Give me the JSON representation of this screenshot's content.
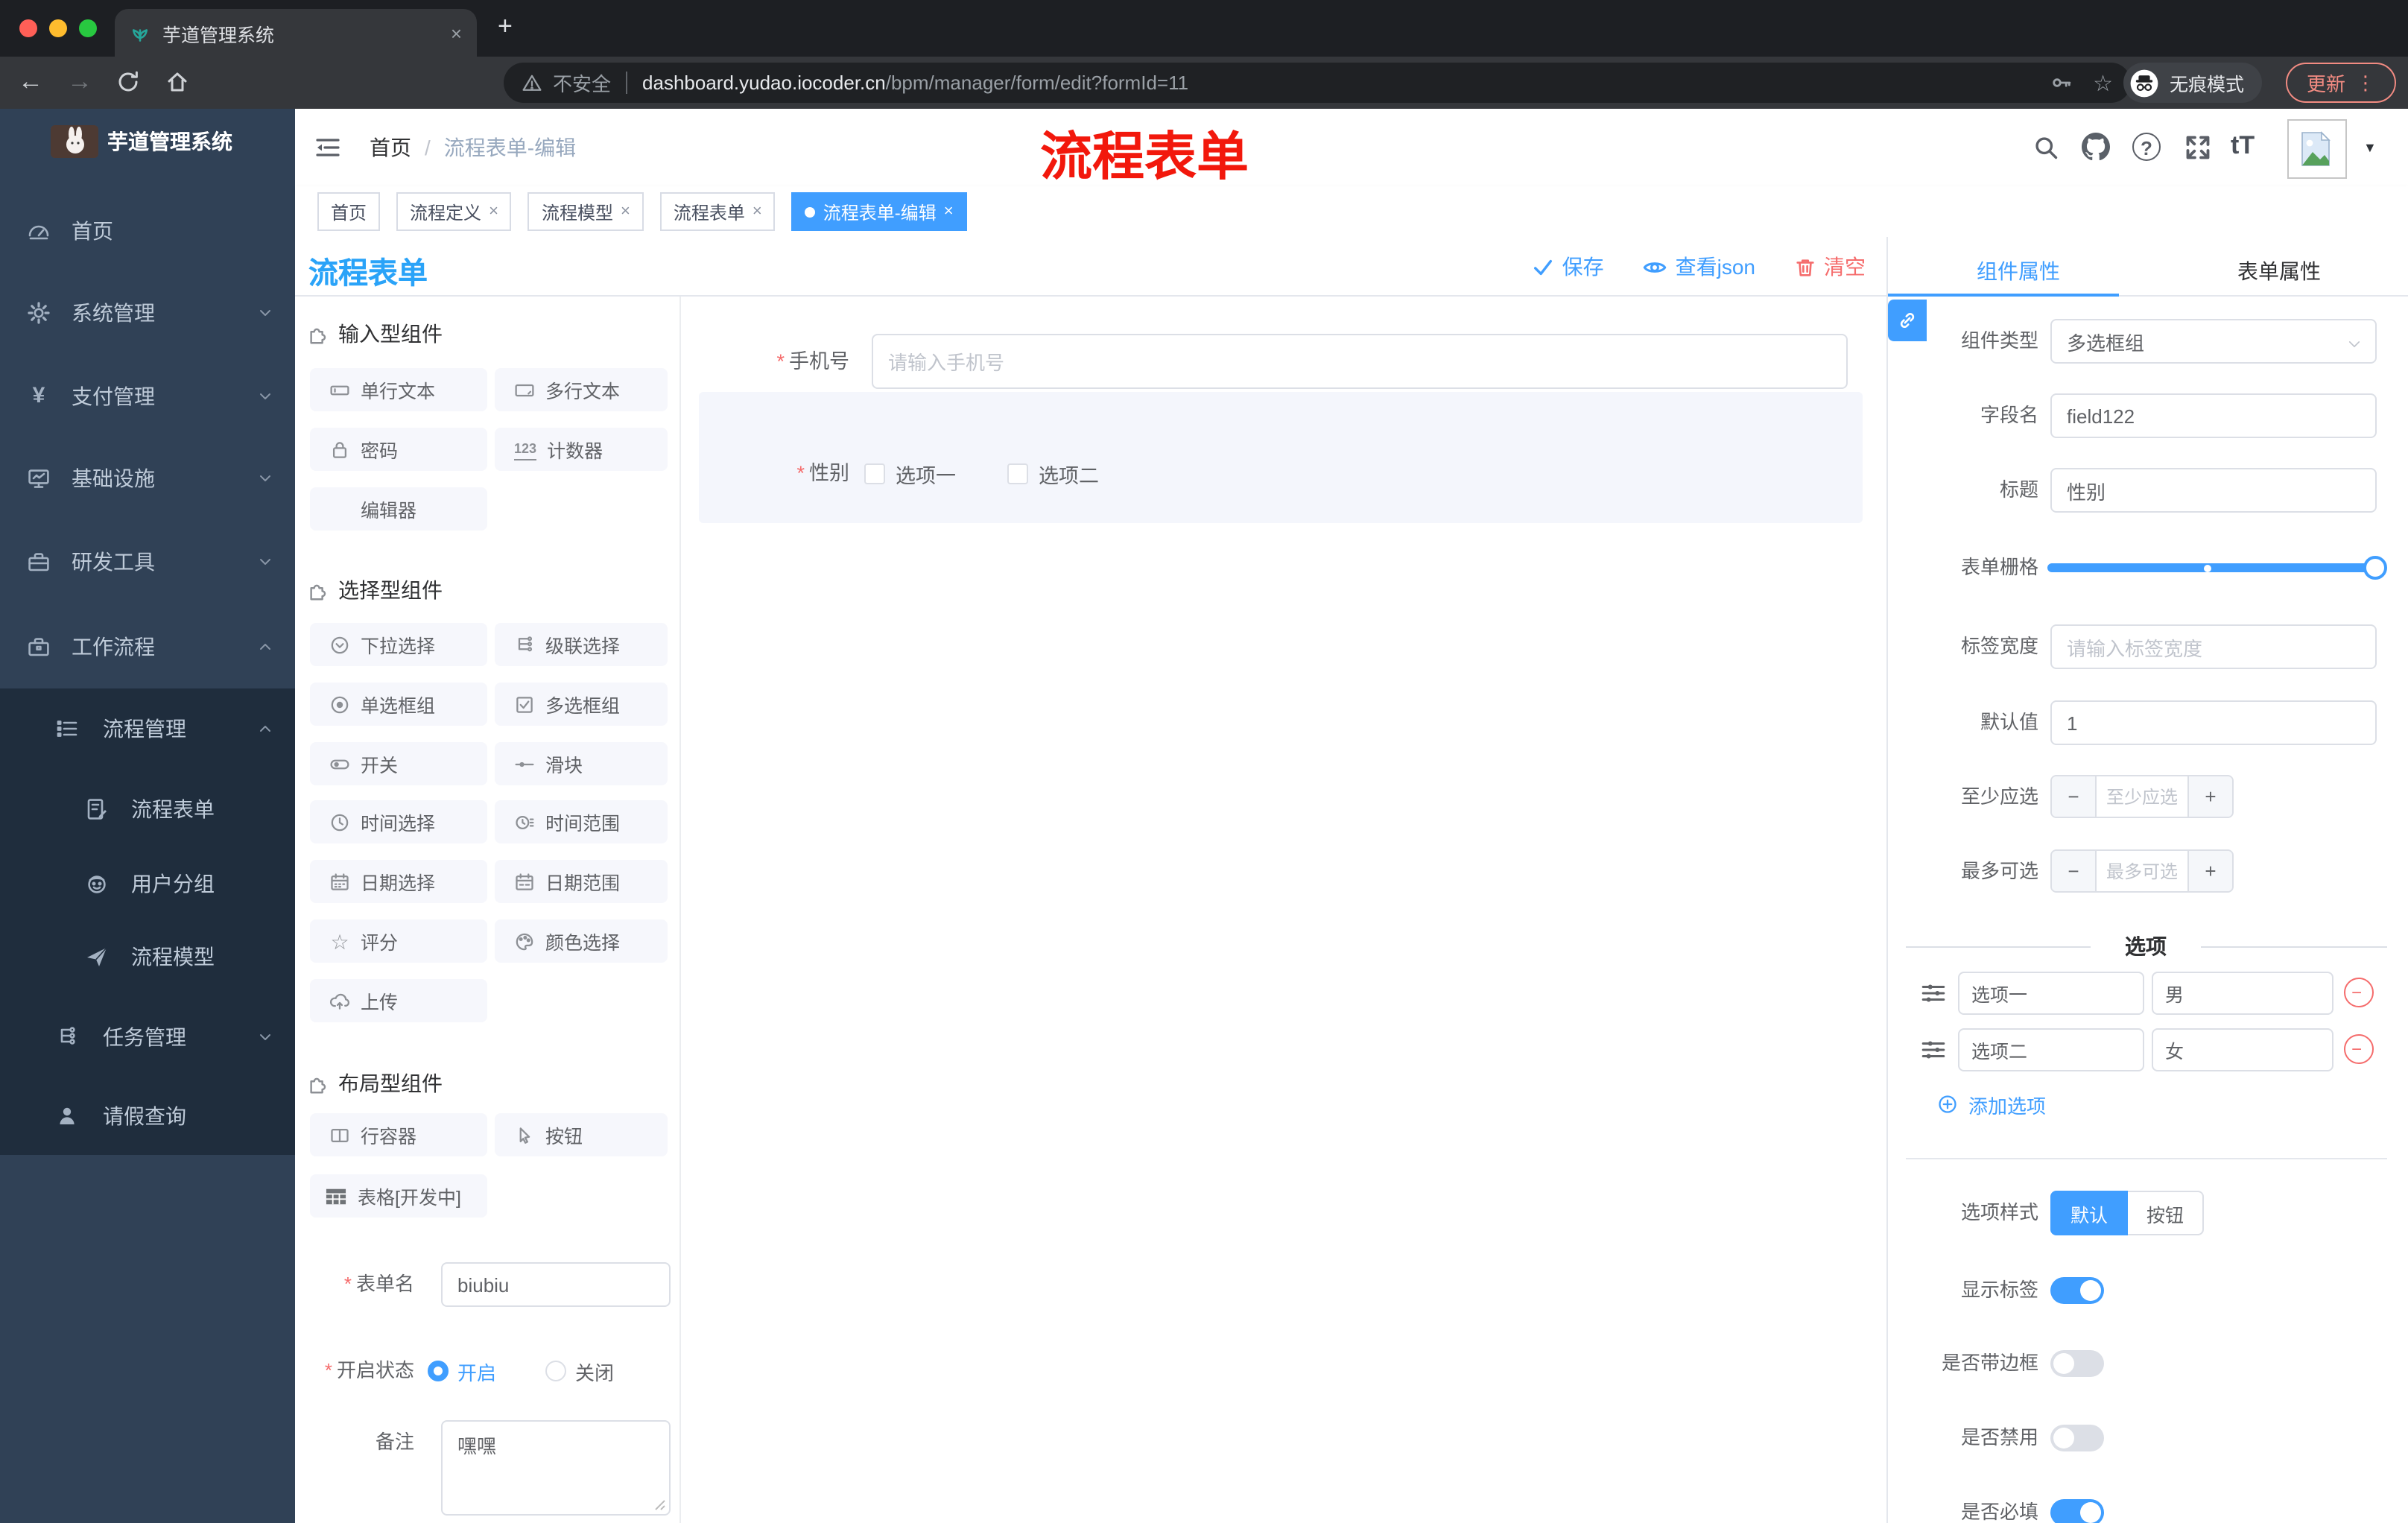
{
  "browser": {
    "tab_title": "芋道管理系统",
    "not_secure": "不安全",
    "url_domain": "dashboard.yudao.iocoder.cn",
    "url_path": "/bpm/manager/form/edit?formId=11",
    "incognito": "无痕模式",
    "update": "更新"
  },
  "icons": {
    "close": "×",
    "plus": "+",
    "kebab": "⋮",
    "caret_down": "▼",
    "back": "←",
    "forward": "→",
    "star": "☆",
    "help": "?",
    "text_size": "tT",
    "yen": "¥",
    "counter": "123",
    "minus": "−",
    "slash": "/",
    "required": "*"
  },
  "sidebar": {
    "logo_title": "芋道管理系统",
    "items": [
      {
        "label": "首页"
      },
      {
        "label": "系统管理"
      },
      {
        "label": "支付管理"
      },
      {
        "label": "基础设施"
      },
      {
        "label": "研发工具"
      },
      {
        "label": "工作流程"
      },
      {
        "label": "流程管理"
      },
      {
        "label": "流程表单"
      },
      {
        "label": "用户分组"
      },
      {
        "label": "流程模型"
      },
      {
        "label": "任务管理"
      },
      {
        "label": "请假查询"
      }
    ]
  },
  "header": {
    "breadcrumb_home": "首页",
    "breadcrumb_current": "流程表单-编辑",
    "annotation": "流程表单"
  },
  "tags": [
    {
      "label": "首页"
    },
    {
      "label": "流程定义"
    },
    {
      "label": "流程模型"
    },
    {
      "label": "流程表单"
    },
    {
      "label": "流程表单-编辑"
    }
  ],
  "designer": {
    "title": "流程表单",
    "save": "保存",
    "view_json": "查看json",
    "clear": "清空"
  },
  "components": {
    "input_section": {
      "title": "输入型组件",
      "items": [
        "单行文本",
        "多行文本",
        "密码",
        "计数器",
        "编辑器"
      ]
    },
    "select_section": {
      "title": "选择型组件",
      "items": [
        "下拉选择",
        "级联选择",
        "单选框组",
        "多选框组",
        "开关",
        "滑块",
        "时间选择",
        "时间范围",
        "日期选择",
        "日期范围",
        "评分",
        "颜色选择",
        "上传"
      ]
    },
    "layout_section": {
      "title": "布局型组件",
      "items": [
        "行容器",
        "按钮",
        "表格[开发中]"
      ]
    }
  },
  "form_meta": {
    "name_label": "表单名",
    "name_value": "biubiu",
    "status_label": "开启状态",
    "status_on": "开启",
    "status_off": "关闭",
    "remark_label": "备注",
    "remark_value": "嘿嘿"
  },
  "canvas": {
    "phone_label": "手机号",
    "phone_placeholder": "请输入手机号",
    "gender_label": "性别",
    "gender_options": [
      "选项一",
      "选项二"
    ]
  },
  "props": {
    "tab_component": "组件属性",
    "tab_form": "表单属性",
    "rows": {
      "type_label": "组件类型",
      "type_value": "多选框组",
      "field_label": "字段名",
      "field_value": "field122",
      "title_label": "标题",
      "title_value": "性别",
      "grid_label": "表单栅格",
      "label_width_label": "标签宽度",
      "label_width_placeholder": "请输入标签宽度",
      "default_label": "默认值",
      "default_value": "1",
      "min_label": "至少应选",
      "min_placeholder": "至少应选",
      "max_label": "最多可选",
      "max_placeholder": "最多可选"
    },
    "options": {
      "divider": "选项",
      "rows": [
        {
          "label": "选项一",
          "value": "男"
        },
        {
          "label": "选项二",
          "value": "女"
        }
      ],
      "add": "添加选项"
    },
    "style": {
      "label": "选项样式",
      "default": "默认",
      "button": "按钮"
    },
    "toggles": [
      {
        "label": "显示标签",
        "on": true
      },
      {
        "label": "是否带边框",
        "on": false
      },
      {
        "label": "是否禁用",
        "on": false
      },
      {
        "label": "是否必填",
        "on": true
      }
    ]
  },
  "colors": {
    "accent": "#409eff",
    "danger": "#f56c6c",
    "annotation_red": "#f2180c",
    "sidebar_bg": "#304156",
    "submenu_bg": "#1f2d3d"
  }
}
